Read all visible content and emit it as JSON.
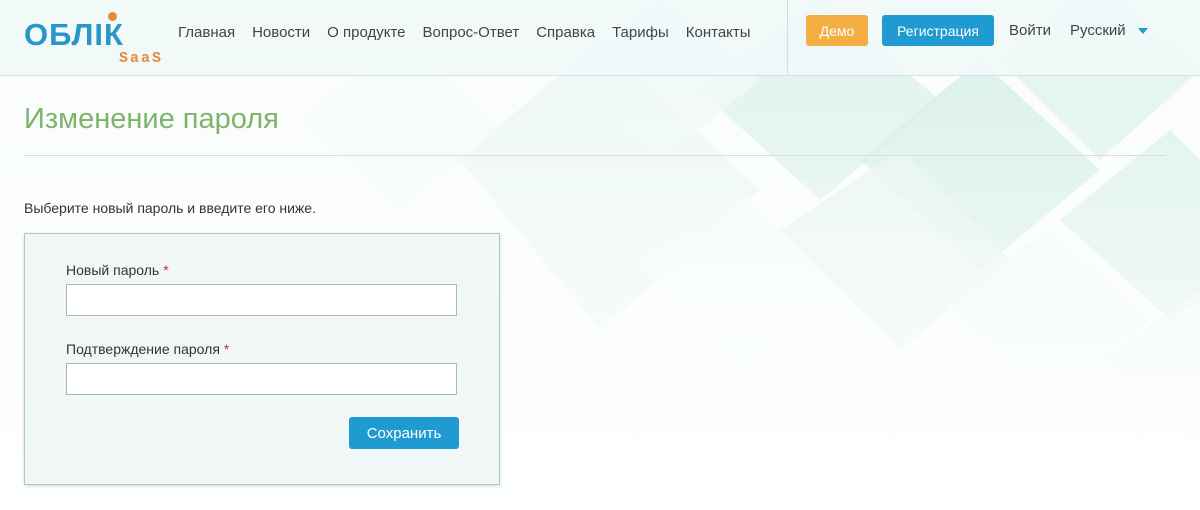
{
  "logo": {
    "main": "ОБЛІК",
    "sub": "SaaS"
  },
  "nav": {
    "items": [
      "Главная",
      "Новости",
      "О продукте",
      "Вопрос-Ответ",
      "Справка",
      "Тарифы",
      "Контакты"
    ]
  },
  "header_actions": {
    "demo_label": "Демо",
    "register_label": "Регистрация",
    "login_label": "Войти",
    "language": "Русский"
  },
  "page": {
    "title": "Изменение пароля",
    "intro": "Выберите новый пароль и введите его ниже."
  },
  "form": {
    "new_password_label": "Новый пароль",
    "confirm_password_label": "Подтверждение пароля",
    "required_mark": "*",
    "new_password_value": "",
    "confirm_password_value": "",
    "save_label": "Сохранить"
  },
  "colors": {
    "brand_blue": "#1f9bd1",
    "brand_orange": "#e8893a",
    "demo_orange": "#f5ae43",
    "title_green": "#7cb56a"
  }
}
